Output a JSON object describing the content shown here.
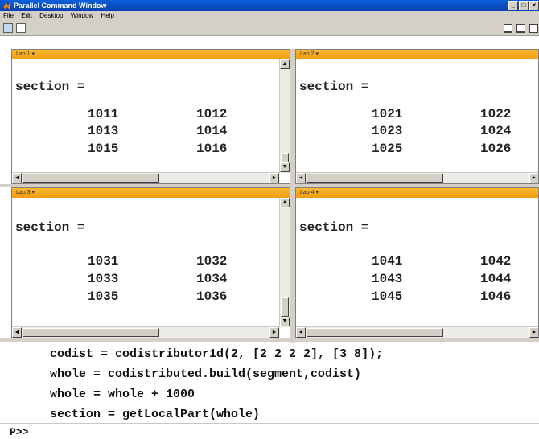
{
  "window": {
    "title": "Parallel Command Window"
  },
  "menu": [
    "File",
    "Edit",
    "Desktop",
    "Window",
    "Help"
  ],
  "labs": [
    {
      "label": "Lab 1 ▾",
      "output_label": "section =",
      "values": [
        "1011",
        "1012",
        "1013",
        "1014",
        "1015",
        "1016"
      ]
    },
    {
      "label": "Lab 2 ▾",
      "output_label": "section =",
      "values": [
        "1021",
        "1022",
        "1023",
        "1024",
        "1025",
        "1026"
      ]
    },
    {
      "label": "Lab 3 ▾",
      "output_label": "section =",
      "values": [
        "1031",
        "1032",
        "1033",
        "1034",
        "1035",
        "1036"
      ]
    },
    {
      "label": "Lab 4 ▾",
      "output_label": "section =",
      "values": [
        "1041",
        "1042",
        "1043",
        "1044",
        "1045",
        "1046"
      ]
    }
  ],
  "command_history": [
    "codist = codistributor1d(2, [2 2 2 2], [3 8]);",
    "whole = codistributed.build(segment,codist)",
    "whole = whole + 1000",
    "section = getLocalPart(whole)"
  ],
  "prompt": "P>>",
  "icons": {
    "app": "matlab-logo-icon",
    "minimize": "minimize-icon",
    "maximize": "maximize-icon",
    "close": "close-icon",
    "toolbar": [
      "mode-icon",
      "new-document-icon"
    ],
    "layout": [
      "grid-layout-icon",
      "tile-layout-icon",
      "single-layout-icon"
    ]
  },
  "colors": {
    "title_bar": "#0a4fc4",
    "lab_header": "#f5a623"
  }
}
